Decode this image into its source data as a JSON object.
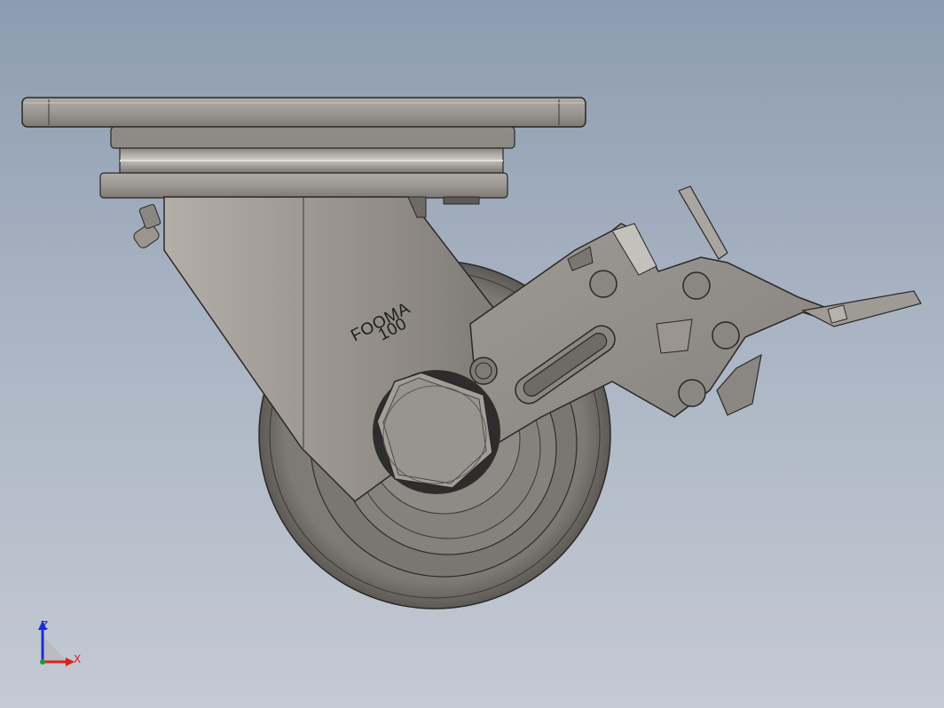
{
  "model": {
    "engraving_line1": "FOOMA",
    "engraving_line2": "100"
  },
  "triad": {
    "z_label": "Z",
    "x_label": "X",
    "z_color": "#1a2ed8",
    "x_color": "#d8231a"
  },
  "colors": {
    "metal_light": "#a39f9a",
    "metal_mid": "#8e8a85",
    "metal_dark": "#6e6a66",
    "edge": "#2a2826"
  }
}
